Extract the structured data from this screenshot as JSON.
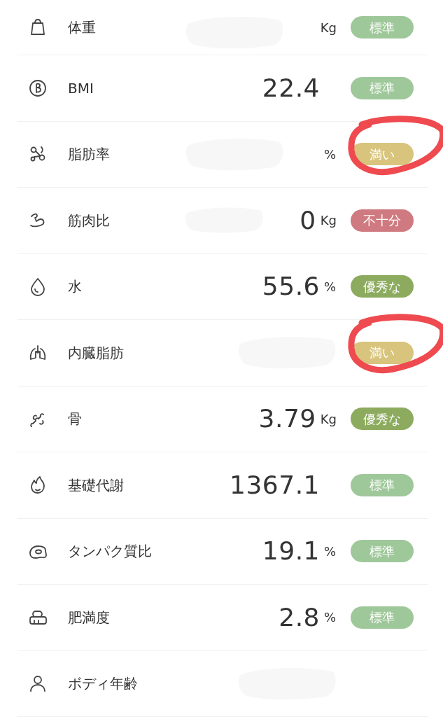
{
  "metrics": [
    {
      "label": "体重",
      "unit": "Kg",
      "redacted": true,
      "circled": false,
      "status": {
        "text": "標準",
        "color": "#9fc89a"
      }
    },
    {
      "label": "BMI",
      "value": "22.4",
      "redacted": false,
      "circled": false,
      "status": {
        "text": "標準",
        "color": "#9fc89a"
      }
    },
    {
      "label": "脂肪率",
      "unit": "%",
      "redacted": true,
      "circled": true,
      "status": {
        "text": "満い",
        "color": "#d8c47c"
      }
    },
    {
      "label": "筋肉比",
      "value": "0",
      "unit": "Kg",
      "redacted": true,
      "circled": false,
      "status": {
        "text": "不十分",
        "color": "#cf7a80"
      }
    },
    {
      "label": "水",
      "value": "55.6",
      "unit": "%",
      "redacted": false,
      "circled": false,
      "status": {
        "text": "優秀な",
        "color": "#8cab5e"
      }
    },
    {
      "label": "内臓脂肪",
      "redacted": true,
      "circled": true,
      "status": {
        "text": "満い",
        "color": "#d8c47c"
      }
    },
    {
      "label": "骨",
      "value": "3.79",
      "unit": "Kg",
      "redacted": false,
      "circled": false,
      "status": {
        "text": "優秀な",
        "color": "#8cab5e"
      }
    },
    {
      "label": "基礎代謝",
      "value": "1367.1",
      "redacted": false,
      "circled": false,
      "status": {
        "text": "標準",
        "color": "#9fc89a"
      }
    },
    {
      "label": "タンパク質比",
      "value": "19.1",
      "unit": "%",
      "redacted": false,
      "circled": false,
      "status": {
        "text": "標準",
        "color": "#9fc89a"
      }
    },
    {
      "label": "肥満度",
      "value": "2.8",
      "unit": "%",
      "redacted": false,
      "circled": false,
      "status": {
        "text": "標準",
        "color": "#9fc89a"
      }
    },
    {
      "label": "ボディ年齢",
      "redacted": true,
      "circled": false
    }
  ]
}
